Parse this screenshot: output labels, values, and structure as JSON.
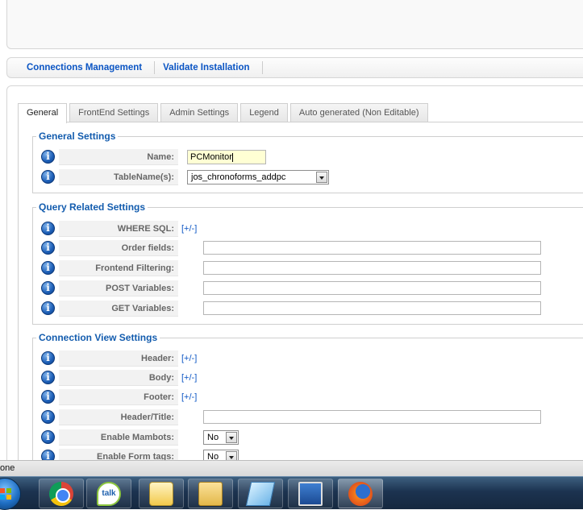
{
  "toolbar": {
    "items": [
      "Connections Management",
      "Validate Installation"
    ]
  },
  "tabs": [
    {
      "label": "General",
      "active": true
    },
    {
      "label": "FrontEnd Settings",
      "active": false
    },
    {
      "label": "Admin Settings",
      "active": false
    },
    {
      "label": "Legend",
      "active": false
    },
    {
      "label": "Auto generated (Non Editable)",
      "active": false
    }
  ],
  "general_settings": {
    "title": "General Settings",
    "name_label": "Name:",
    "name_value": "PCMonitor",
    "tablename_label": "TableName(s):",
    "tablename_value": "jos_chronoforms_addpc"
  },
  "query_settings": {
    "title": "Query Related Settings",
    "where_label": "WHERE SQL:",
    "where_toggle": "[+/-]",
    "order_label": "Order fields:",
    "filtering_label": "Frontend Filtering:",
    "post_label": "POST Variables:",
    "get_label": "GET Variables:"
  },
  "view_settings": {
    "title": "Connection View Settings",
    "header_label": "Header:",
    "header_toggle": "[+/-]",
    "body_label": "Body:",
    "body_toggle": "[+/-]",
    "footer_label": "Footer:",
    "footer_toggle": "[+/-]",
    "header_title_label": "Header/Title:",
    "mambots_label": "Enable Mambots:",
    "mambots_value": "No",
    "formtags_label": "Enable Form tags:",
    "formtags_value": "No"
  },
  "statusbar": {
    "text": "one"
  },
  "taskbar": {
    "talk_text": "talk",
    "apps": [
      "start-orb",
      "chrome-icon",
      "google-talk-icon",
      "mail-icon",
      "folder-icon",
      "notes-icon",
      "remote-desktop-icon",
      "firefox-icon"
    ]
  },
  "colors": {
    "link": "#0b55c4",
    "legend": "#135cae",
    "name_input_bg": "#ffffd4"
  }
}
